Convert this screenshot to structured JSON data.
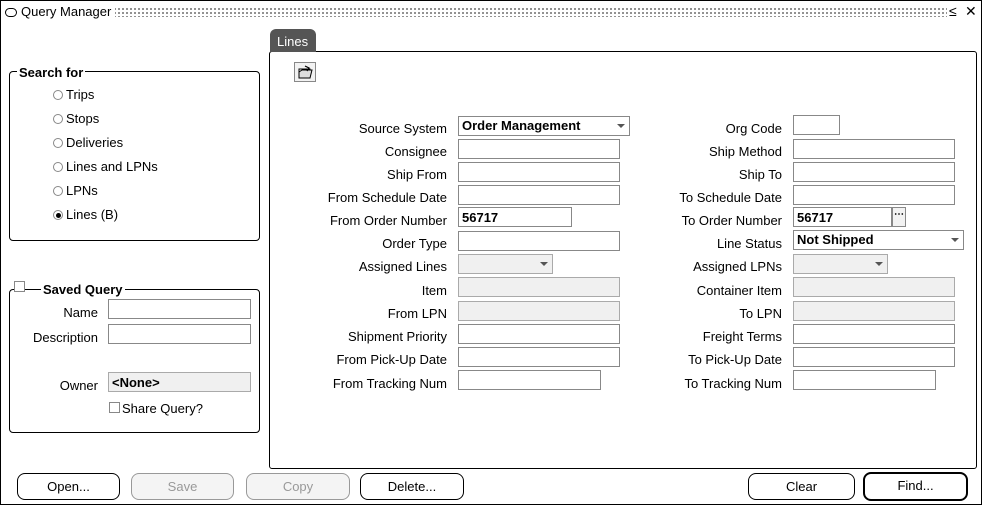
{
  "window": {
    "title": "Query Manager",
    "minimize_glyph": "≤",
    "close_glyph": "✕"
  },
  "search_for": {
    "legend": "Search for",
    "options": [
      {
        "label": "Trips",
        "selected": false
      },
      {
        "label": "Stops",
        "selected": false
      },
      {
        "label": "Deliveries",
        "selected": false
      },
      {
        "label": "Lines and LPNs",
        "selected": false
      },
      {
        "label": "LPNs",
        "selected": false
      },
      {
        "label": "Lines (B)",
        "selected": true
      }
    ]
  },
  "saved_query": {
    "legend": "Saved Query",
    "name_label": "Name",
    "name_value": "",
    "description_label": "Description",
    "description_value": "",
    "owner_label": "Owner",
    "owner_value": "<None>",
    "share_label": "Share Query?"
  },
  "tab": {
    "label": "Lines",
    "toolbar_icon": "folder-open-icon"
  },
  "left_fields": {
    "source_system": {
      "label": "Source System",
      "value": "Order Management"
    },
    "consignee": {
      "label": "Consignee",
      "value": ""
    },
    "ship_from": {
      "label": "Ship From",
      "value": ""
    },
    "from_schedule_date": {
      "label": "From Schedule Date",
      "value": ""
    },
    "from_order_number": {
      "label": "From Order Number",
      "value": "56717"
    },
    "order_type": {
      "label": "Order Type",
      "value": ""
    },
    "assigned_lines": {
      "label": "Assigned Lines",
      "value": ""
    },
    "item": {
      "label": "Item",
      "value": ""
    },
    "from_lpn": {
      "label": "From LPN",
      "value": ""
    },
    "shipment_priority": {
      "label": "Shipment Priority",
      "value": ""
    },
    "from_pickup_date": {
      "label": "From Pick-Up Date",
      "value": ""
    },
    "from_tracking_num": {
      "label": "From Tracking Num",
      "value": ""
    }
  },
  "right_fields": {
    "org_code": {
      "label": "Org Code",
      "value": ""
    },
    "ship_method": {
      "label": "Ship Method",
      "value": ""
    },
    "ship_to": {
      "label": "Ship To",
      "value": ""
    },
    "to_schedule_date": {
      "label": "To Schedule Date",
      "value": ""
    },
    "to_order_number": {
      "label": "To Order Number",
      "value": "56717"
    },
    "line_status": {
      "label": "Line Status",
      "value": "Not Shipped"
    },
    "assigned_lpns": {
      "label": "Assigned LPNs",
      "value": ""
    },
    "container_item": {
      "label": "Container Item",
      "value": ""
    },
    "to_lpn": {
      "label": "To LPN",
      "value": ""
    },
    "freight_terms": {
      "label": "Freight Terms",
      "value": ""
    },
    "to_pickup_date": {
      "label": "To Pick-Up Date",
      "value": ""
    },
    "to_tracking_num": {
      "label": "To Tracking Num",
      "value": ""
    }
  },
  "buttons": {
    "open": "Open...",
    "save": "Save",
    "copy": "Copy",
    "delete": "Delete...",
    "clear": "Clear",
    "find": "Find..."
  }
}
